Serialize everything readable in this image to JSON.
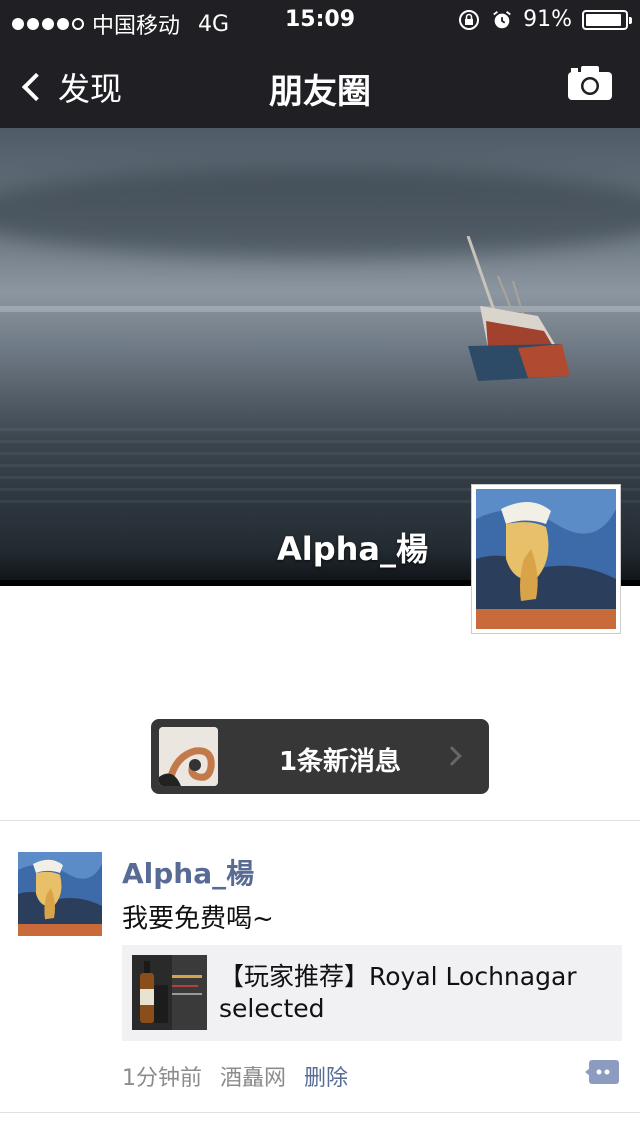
{
  "status_bar": {
    "carrier": "中国移动",
    "network": "4G",
    "time": "15:09",
    "battery": "91%",
    "battery_level": 0.91
  },
  "nav": {
    "back_label": "发现",
    "title": "朋友圈"
  },
  "cover": {
    "username": "Alpha_楊"
  },
  "new_message": {
    "label": "1条新消息"
  },
  "post": {
    "author": "Alpha_楊",
    "text": "我要免费喝~",
    "link_title": "【玩家推荐】Royal Lochnagar selected",
    "time": "1分钟前",
    "source": "酒矗网",
    "delete_label": "删除"
  },
  "colors": {
    "bar_bg": "#1f1f24",
    "link_blue": "#576b95",
    "card_bg": "#f1f1f3"
  }
}
